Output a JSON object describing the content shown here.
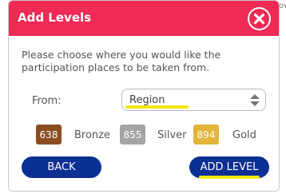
{
  "dialog": {
    "title": "Add Levels",
    "instructions": "Please choose where you would like the participation places to be taken from.",
    "from_label": "From:",
    "from_select": {
      "value": "Region"
    },
    "levels": [
      {
        "count": "638",
        "label": "Bronze",
        "color": "#8a4d22"
      },
      {
        "count": "855",
        "label": "Silver",
        "color": "#a4a4a4"
      },
      {
        "count": "894",
        "label": "Gold",
        "color": "#e1b43b"
      }
    ],
    "back_label": "BACK",
    "add_label": "ADD LEVEL"
  },
  "colors": {
    "header": "#ef2a55",
    "button": "#0c2f93",
    "highlight": "#f3e80e"
  },
  "background": {
    "edge_text": "ov"
  }
}
